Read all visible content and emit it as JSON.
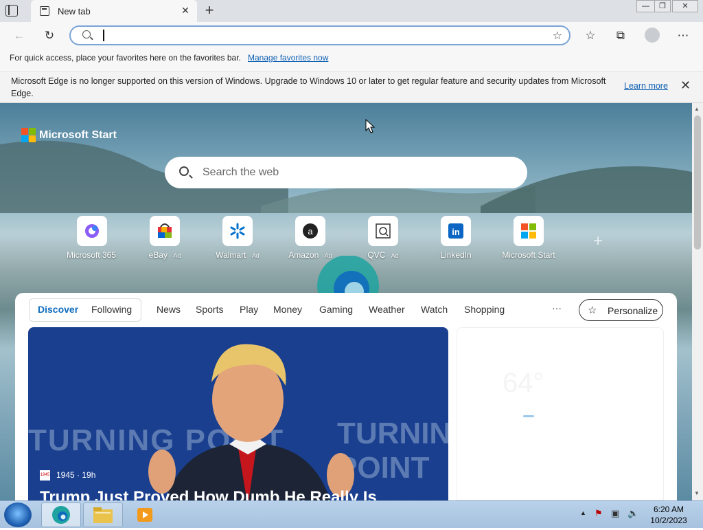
{
  "browser": {
    "tab_title": "New tab",
    "tab_close": "✕",
    "new_tab": "+",
    "window_controls": [
      "—",
      "❐",
      "✕"
    ],
    "address_value": "",
    "favbar_text": "For quick access, place your favorites here on the favorites bar.",
    "favbar_link": "Manage favorites now"
  },
  "notice": {
    "message": "Microsoft Edge is no longer supported on this version of Windows. Upgrade to Windows 10 or later to get regular feature and security updates from Microsoft Edge.",
    "learn_more": "Learn more",
    "close": "✕"
  },
  "newtab": {
    "brand": "Microsoft Start",
    "search_placeholder": "Search the web",
    "add_shortcut": "+",
    "tiles": [
      {
        "label": "Microsoft 365",
        "ad": ""
      },
      {
        "label": "eBay",
        "ad": "· Ad"
      },
      {
        "label": "Walmart",
        "ad": "· Ad"
      },
      {
        "label": "Amazon",
        "ad": "· Ad"
      },
      {
        "label": "QVC",
        "ad": "· Ad"
      },
      {
        "label": "LinkedIn",
        "ad": ""
      },
      {
        "label": "Microsoft Start",
        "ad": ""
      }
    ]
  },
  "feed": {
    "tabs": [
      "Discover",
      "Following",
      "News",
      "Sports",
      "Play",
      "Money",
      "Gaming",
      "Weather",
      "Watch",
      "Shopping"
    ],
    "more": "···",
    "personalize": "Personalize",
    "hero": {
      "source": "1945 · 19h",
      "source_badge": "1945",
      "headline": "Trump Just Proved How Dumb He Really Is",
      "backdrop_text": "TURNING POINT"
    },
    "weather_temp": "64°"
  },
  "taskbar": {
    "time": "6:20 AM",
    "date": "10/2/2023"
  },
  "colors": {
    "accent": "#0c5fb3",
    "active_tab": "#0f6cbd",
    "taskbar": "#b9d1ea"
  }
}
